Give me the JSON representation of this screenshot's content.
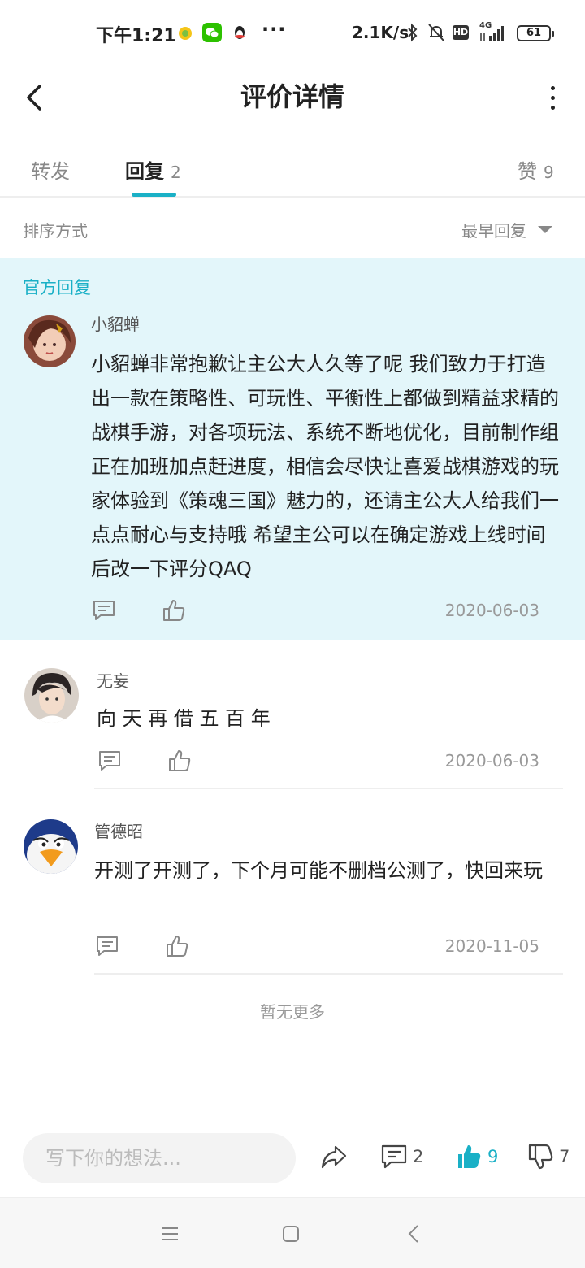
{
  "status_bar": {
    "time": "下午1:21",
    "more": "···",
    "net_speed": "2.1K/s",
    "hd": "HD",
    "net_type": "4G",
    "battery": "61"
  },
  "header": {
    "title": "评价详情"
  },
  "tabs": [
    {
      "label": "转发",
      "count": ""
    },
    {
      "label": "回复",
      "count": "2"
    },
    {
      "label": "赞",
      "count": "9"
    }
  ],
  "sort": {
    "label": "排序方式",
    "value": "最早回复"
  },
  "official": {
    "label": "官方回复",
    "author": "小貂蝉",
    "text": "小貂蝉非常抱歉让主公大人久等了呢 我们致力于打造出一款在策略性、可玩性、平衡性上都做到精益求精的战棋手游，对各项玩法、系统不断地优化，目前制作组正在加班加点赶进度，相信会尽快让喜爱战棋游戏的玩家体验到《策魂三国》魅力的，还请主公大人给我们一点点耐心与支持哦 希望主公可以在确定游戏上线时间后改一下评分QAQ",
    "date": "2020-06-03"
  },
  "replies": [
    {
      "author": "无妄",
      "text": "向 天 再 借 五 百 年",
      "date": "2020-06-03"
    },
    {
      "author": "管德昭",
      "text": "开测了开测了，下个月可能不删档公测了，快回来玩",
      "date": "2020-11-05"
    }
  ],
  "no_more": "暂无更多",
  "bottom_bar": {
    "placeholder": "写下你的想法...",
    "comment_count": "2",
    "like_count": "9",
    "dislike_count": "7"
  },
  "colors": {
    "accent": "#1ab0c6",
    "official_bg": "#e3f6fa"
  }
}
